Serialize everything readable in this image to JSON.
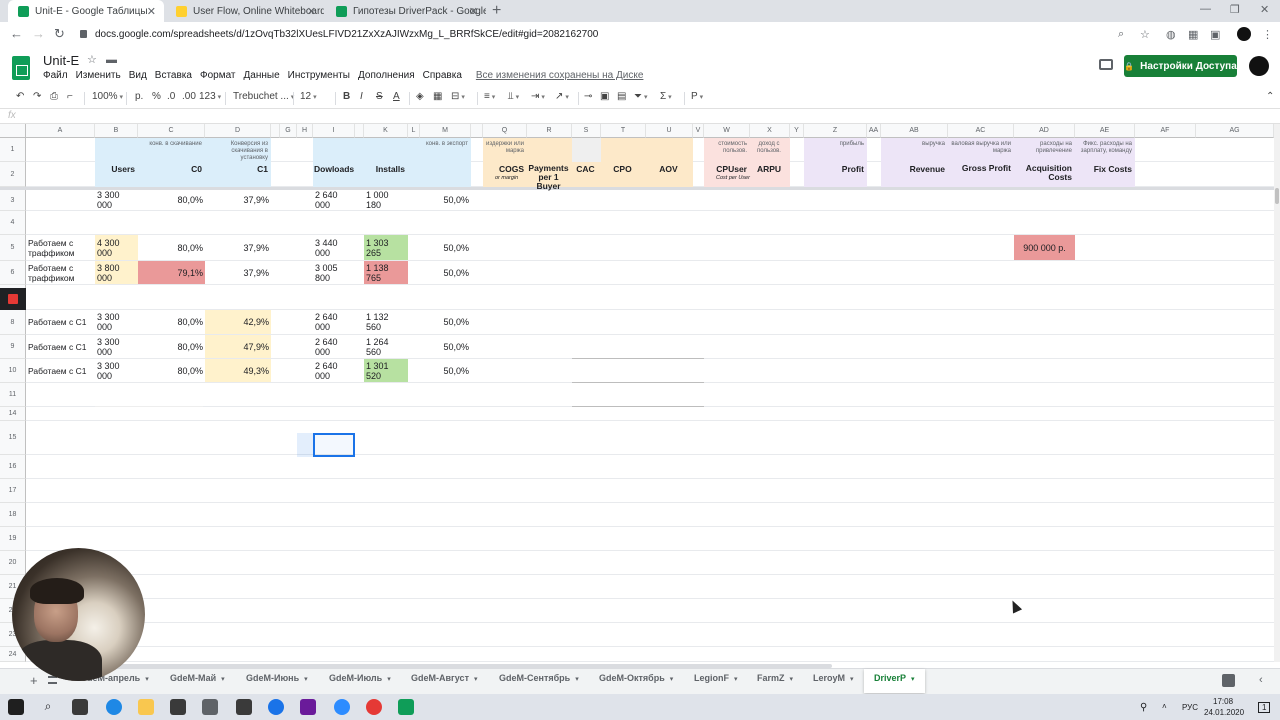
{
  "browser": {
    "tabs": [
      {
        "label": "Unit-E - Google Таблицы",
        "icon": "sheets-icon",
        "active": true
      },
      {
        "label": "User Flow, Online Whiteboard fo",
        "icon": "miro-icon",
        "active": false
      },
      {
        "label": "Гипотезы DriverPack - Google Та",
        "icon": "sheets-icon",
        "active": false
      }
    ],
    "url": "docs.google.com/spreadsheets/d/1zOvqTb32lXUesLFIVD21ZxXzAJIWzxMg_L_BRRfSkCE/edit#gid=2082162700"
  },
  "doc": {
    "title": "Unit-E",
    "menu": [
      "Файл",
      "Изменить",
      "Вид",
      "Вставка",
      "Формат",
      "Данные",
      "Инструменты",
      "Дополнения",
      "Справка"
    ],
    "saved_status": "Все изменения сохранены на Диске",
    "share_label": "Настройки Доступа"
  },
  "toolbar": {
    "zoom": "100%",
    "currency": "р.",
    "percent": "%",
    "dec_decrease": ".0",
    "dec_increase": ".00",
    "format_more": "123",
    "font": "Trebuchet ...",
    "font_size": "12",
    "bold": "B",
    "italic": "I",
    "strike": "S",
    "text_color": "A",
    "sigma": "Σ"
  },
  "formula_bar": {
    "label": "fx",
    "value": ""
  },
  "columns": [
    "A",
    "B",
    "C",
    "D",
    "",
    "G",
    "H",
    "I",
    "",
    "K",
    "L",
    "M",
    "",
    "Q",
    "R",
    "S",
    "T",
    "U",
    "V",
    "W",
    "X",
    "Y",
    "Z",
    "AA",
    "AB",
    "AC",
    "AD",
    "AE",
    "AF",
    "AG"
  ],
  "rows": [
    "1",
    "2",
    "3",
    "4",
    "5",
    "6",
    "7",
    "8",
    "9",
    "10",
    "11",
    "14",
    "15",
    "16",
    "17",
    "18",
    "19",
    "20",
    "21",
    "22",
    "23",
    "24"
  ],
  "header": {
    "B": {
      "main": "Users"
    },
    "C": {
      "small": "конв. в скачивание",
      "main": "C0"
    },
    "D": {
      "small": "Конверсия из скачивания в установку",
      "main": "C1"
    },
    "I": {
      "main": "Dowloads"
    },
    "K": {
      "main": "Installs"
    },
    "M": {
      "small": "конв. в экспорт"
    },
    "Q": {
      "small": "издержки или маржа",
      "main": "COGS",
      "sub": "or margin"
    },
    "R": {
      "main": "Payments per 1 Buyer"
    },
    "S": {
      "main": "CAC"
    },
    "T": {
      "main": "CPO"
    },
    "U": {
      "main": "AOV"
    },
    "W": {
      "small": "стоимость пользов.",
      "main": "CPUser",
      "sub": "Cost per User"
    },
    "X": {
      "small": "доход с пользов.",
      "main": "ARPU"
    },
    "Z": {
      "small": "прибыль",
      "main": "Profit"
    },
    "AB": {
      "small": "выручка",
      "main": "Revenue"
    },
    "AC": {
      "small": "валовая выручка или маржа",
      "main": "Gross Profit"
    },
    "AD": {
      "small": "расходы на привлечение",
      "main": "Acquisition Costs"
    },
    "AE": {
      "small": "Фикс. расходы на зарплату, команду",
      "main": "Fix Costs"
    }
  },
  "data_rows": [
    {
      "row": "3",
      "A": "",
      "B": "3 300 000",
      "C": "80,0%",
      "D": "37,9%",
      "I": "2 640 000",
      "K": "1 000 180",
      "M": "50,0%"
    },
    {
      "row": "5",
      "A": "Работаем с траффиком",
      "B": "4 300 000",
      "C": "80,0%",
      "D": "37,9%",
      "I": "3 440 000",
      "K": "1 303 265",
      "M": "50,0%",
      "AD": "900 000 р."
    },
    {
      "row": "6",
      "A": "Работаем с траффиком",
      "B": "3 800 000",
      "C": "79,1%",
      "D": "37,9%",
      "I": "3 005 800",
      "K": "1 138 765",
      "M": "50,0%"
    },
    {
      "row": "8",
      "A": "Работаем с С1",
      "B": "3 300 000",
      "C": "80,0%",
      "D": "42,9%",
      "I": "2 640 000",
      "K": "1 132 560",
      "M": "50,0%"
    },
    {
      "row": "9",
      "A": "Работаем с С1",
      "B": "3 300 000",
      "C": "80,0%",
      "D": "47,9%",
      "I": "2 640 000",
      "K": "1 264 560",
      "M": "50,0%"
    },
    {
      "row": "10",
      "A": "Работаем с С1",
      "B": "3 300 000",
      "C": "80,0%",
      "D": "49,3%",
      "I": "2 640 000",
      "K": "1 301 520",
      "M": "50,0%"
    }
  ],
  "sheet_tabs": [
    "GdeM-апрель",
    "GdeM-Май",
    "GdeM-Июнь",
    "GdeM-Июль",
    "GdeM-Август",
    "GdeM-Сентябрь",
    "GdeM-Октябрь",
    "LegionF",
    "FarmZ",
    "LeroyM",
    "DriverP"
  ],
  "active_sheet": "DriverP",
  "taskbar": {
    "lang": "РУС",
    "time": "17:08",
    "date": "24.01.2020",
    "notifications": "1"
  },
  "colors": {
    "header_blue": "#dbeefa",
    "header_orange": "#fde9c9",
    "header_gray": "#efefef",
    "header_red": "#fbe1de",
    "header_purple": "#ede5f7",
    "green_fill": "#b7e1a1",
    "red_fill": "#ea9999",
    "yellow_fill": "#fff2cc",
    "share_green": "#188038"
  }
}
